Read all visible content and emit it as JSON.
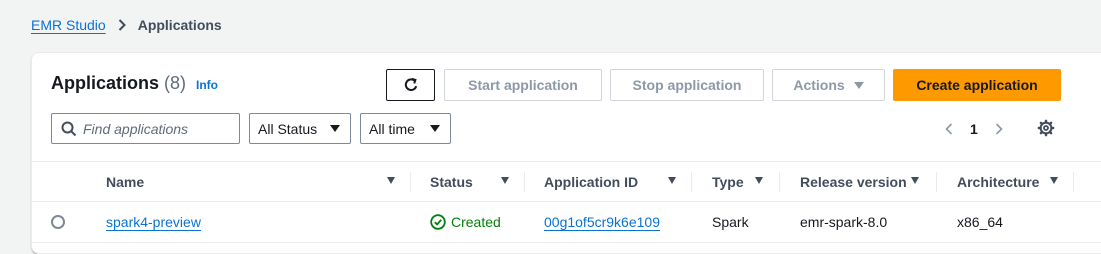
{
  "breadcrumb": {
    "parent": "EMR Studio",
    "current": "Applications"
  },
  "header": {
    "title": "Applications",
    "count": "(8)",
    "info": "Info"
  },
  "toolbar": {
    "start_label": "Start application",
    "stop_label": "Stop application",
    "actions_label": "Actions",
    "create_label": "Create application",
    "accent_color": "#ff9900"
  },
  "filters": {
    "search_placeholder": "Find applications",
    "status_value": "All Status",
    "time_value": "All time"
  },
  "pagination": {
    "current_page": "1"
  },
  "table": {
    "columns": [
      "Name",
      "Status",
      "Application ID",
      "Type",
      "Release version",
      "Architecture"
    ],
    "rows": [
      {
        "name": "spark4-preview",
        "status": "Created",
        "app_id": "00g1of5cr9k6e109",
        "type": "Spark",
        "release": "emr-spark-8.0",
        "arch": "x86_64"
      }
    ]
  },
  "colors": {
    "link": "#0972d3",
    "success": "#037f0c"
  },
  "icons": [
    "chevron-right-icon",
    "refresh-icon",
    "caret-down-icon",
    "search-icon",
    "chevron-left-icon",
    "gear-icon",
    "sort-caret-icon",
    "check-circle-icon"
  ]
}
